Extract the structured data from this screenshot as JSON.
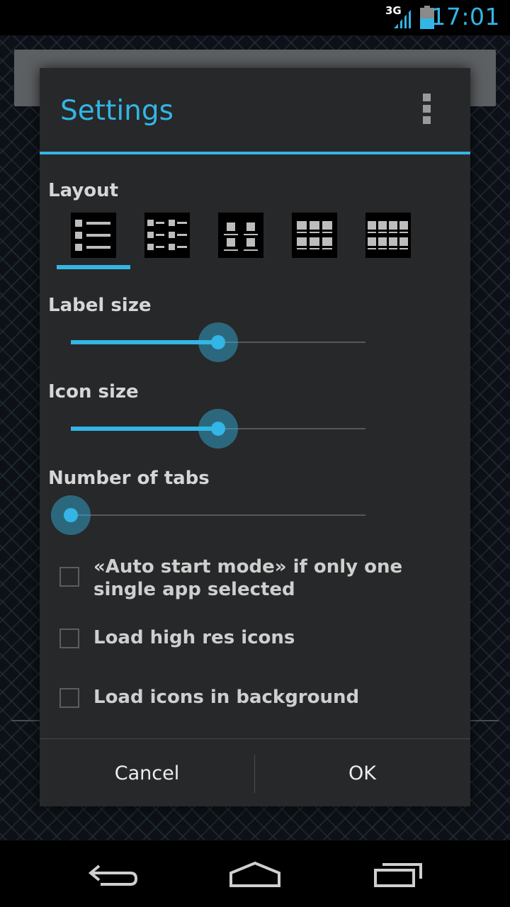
{
  "status_bar": {
    "network": "3G",
    "time": "17:01"
  },
  "dialog": {
    "title": "Settings",
    "layout": {
      "label": "Layout",
      "selected_index": 0,
      "options": [
        "list",
        "two-column-list",
        "grid-2",
        "grid-3",
        "grid-4"
      ]
    },
    "label_size": {
      "label": "Label size",
      "value_fraction": 0.5
    },
    "icon_size": {
      "label": "Icon size",
      "value_fraction": 0.5
    },
    "number_of_tabs": {
      "label": "Number of tabs",
      "value_fraction": 0.0
    },
    "checkboxes": [
      {
        "label": "«Auto start mode» if only one single app selected",
        "checked": false
      },
      {
        "label": "Load high res icons",
        "checked": false
      },
      {
        "label": "Load icons in background",
        "checked": false
      }
    ],
    "buttons": {
      "cancel": "Cancel",
      "ok": "OK"
    }
  },
  "icons": {
    "overflow": "overflow-menu-icon",
    "back": "back-icon",
    "home": "home-icon",
    "recents": "recents-icon"
  },
  "colors": {
    "accent": "#33b5e5",
    "dialog_bg": "#272829"
  }
}
